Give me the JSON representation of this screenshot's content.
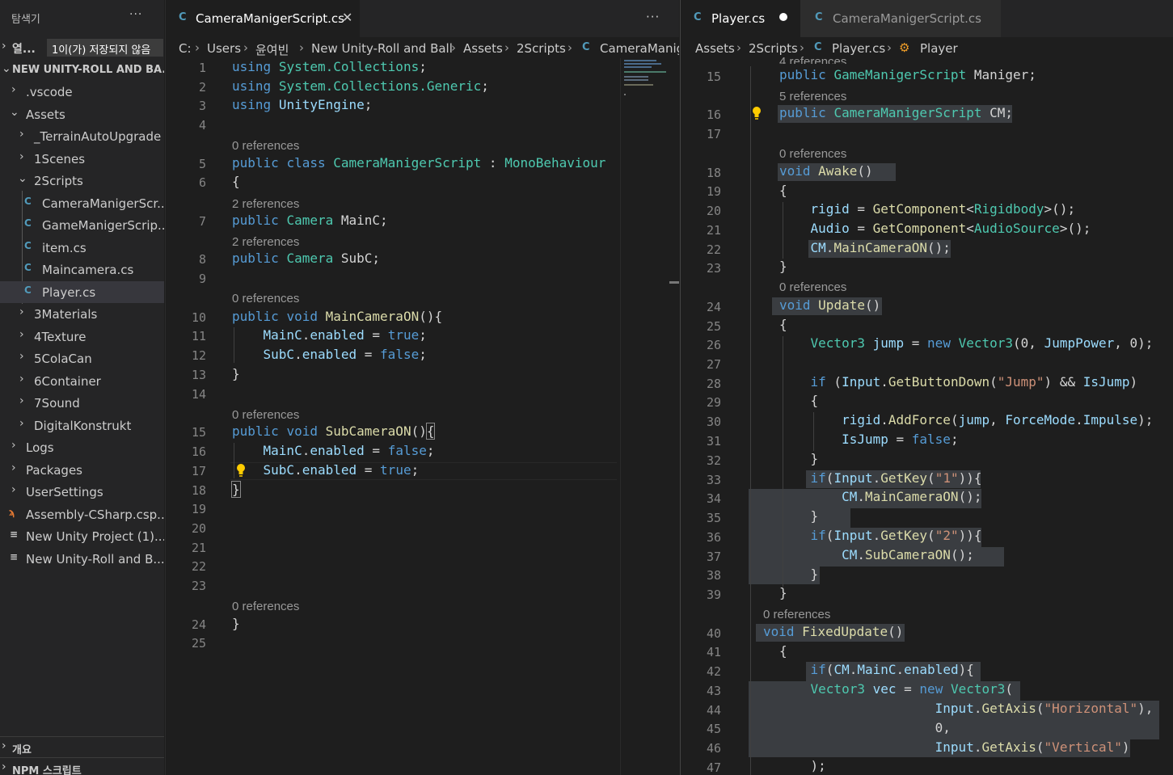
{
  "sidebar": {
    "title": "탐색기",
    "more": "···",
    "open_editors": {
      "label": "열...",
      "badge": "1이(가) 저장되지 않음"
    },
    "project": "NEW UNITY-ROLL AND BA...",
    "tree": [
      {
        "label": ".vscode"
      },
      {
        "label": "Assets"
      },
      {
        "label": "_TerrainAutoUpgrade"
      },
      {
        "label": "1Scenes"
      },
      {
        "label": "2Scripts"
      },
      {
        "label": "CameraManigerScr..."
      },
      {
        "label": "GameManigerScrip..."
      },
      {
        "label": "item.cs"
      },
      {
        "label": "Maincamera.cs"
      },
      {
        "label": "Player.cs"
      },
      {
        "label": "3Materials"
      },
      {
        "label": "4Texture"
      },
      {
        "label": "5ColaCan"
      },
      {
        "label": "6Container"
      },
      {
        "label": "7Sound"
      },
      {
        "label": "DigitalKonstrukt"
      },
      {
        "label": "Logs"
      },
      {
        "label": "Packages"
      },
      {
        "label": "UserSettings"
      },
      {
        "label": "Assembly-CSharp.csp..."
      },
      {
        "label": "New Unity Project (1)...."
      },
      {
        "label": "New Unity-Roll and B..."
      }
    ],
    "outline": "개요",
    "npm": "NPM 스크립트"
  },
  "left": {
    "tab": {
      "name": "CameraManigerScript.cs"
    },
    "more": "···",
    "breadcrumb": [
      "C:",
      "Users",
      "윤여빈",
      "New Unity-Roll and Ball",
      "Assets",
      "2Scripts",
      "CameraManig"
    ]
  },
  "right": {
    "tabs": [
      {
        "name": "Player.cs"
      },
      {
        "name": "CameraManigerScript.cs"
      }
    ],
    "breadcrumb": [
      "Assets",
      "2Scripts",
      "Player.cs",
      "Player"
    ]
  },
  "lens": {
    "zero": "0 references",
    "two": "2 references",
    "four": "4 references",
    "five": "5 references"
  },
  "icons": {
    "csharp": "C#",
    "lightbulb": "lightbulb-icon",
    "chevron": "chevron-icon",
    "rss": "rss-icon",
    "file": "file-icon",
    "close": "close-icon"
  },
  "colors": {
    "keyword": "#569cd6",
    "type": "#4ec9b0",
    "variable": "#9cdcfe",
    "function": "#dcdcaa",
    "string": "#ce9178",
    "csharp_icon": "#519aba"
  }
}
